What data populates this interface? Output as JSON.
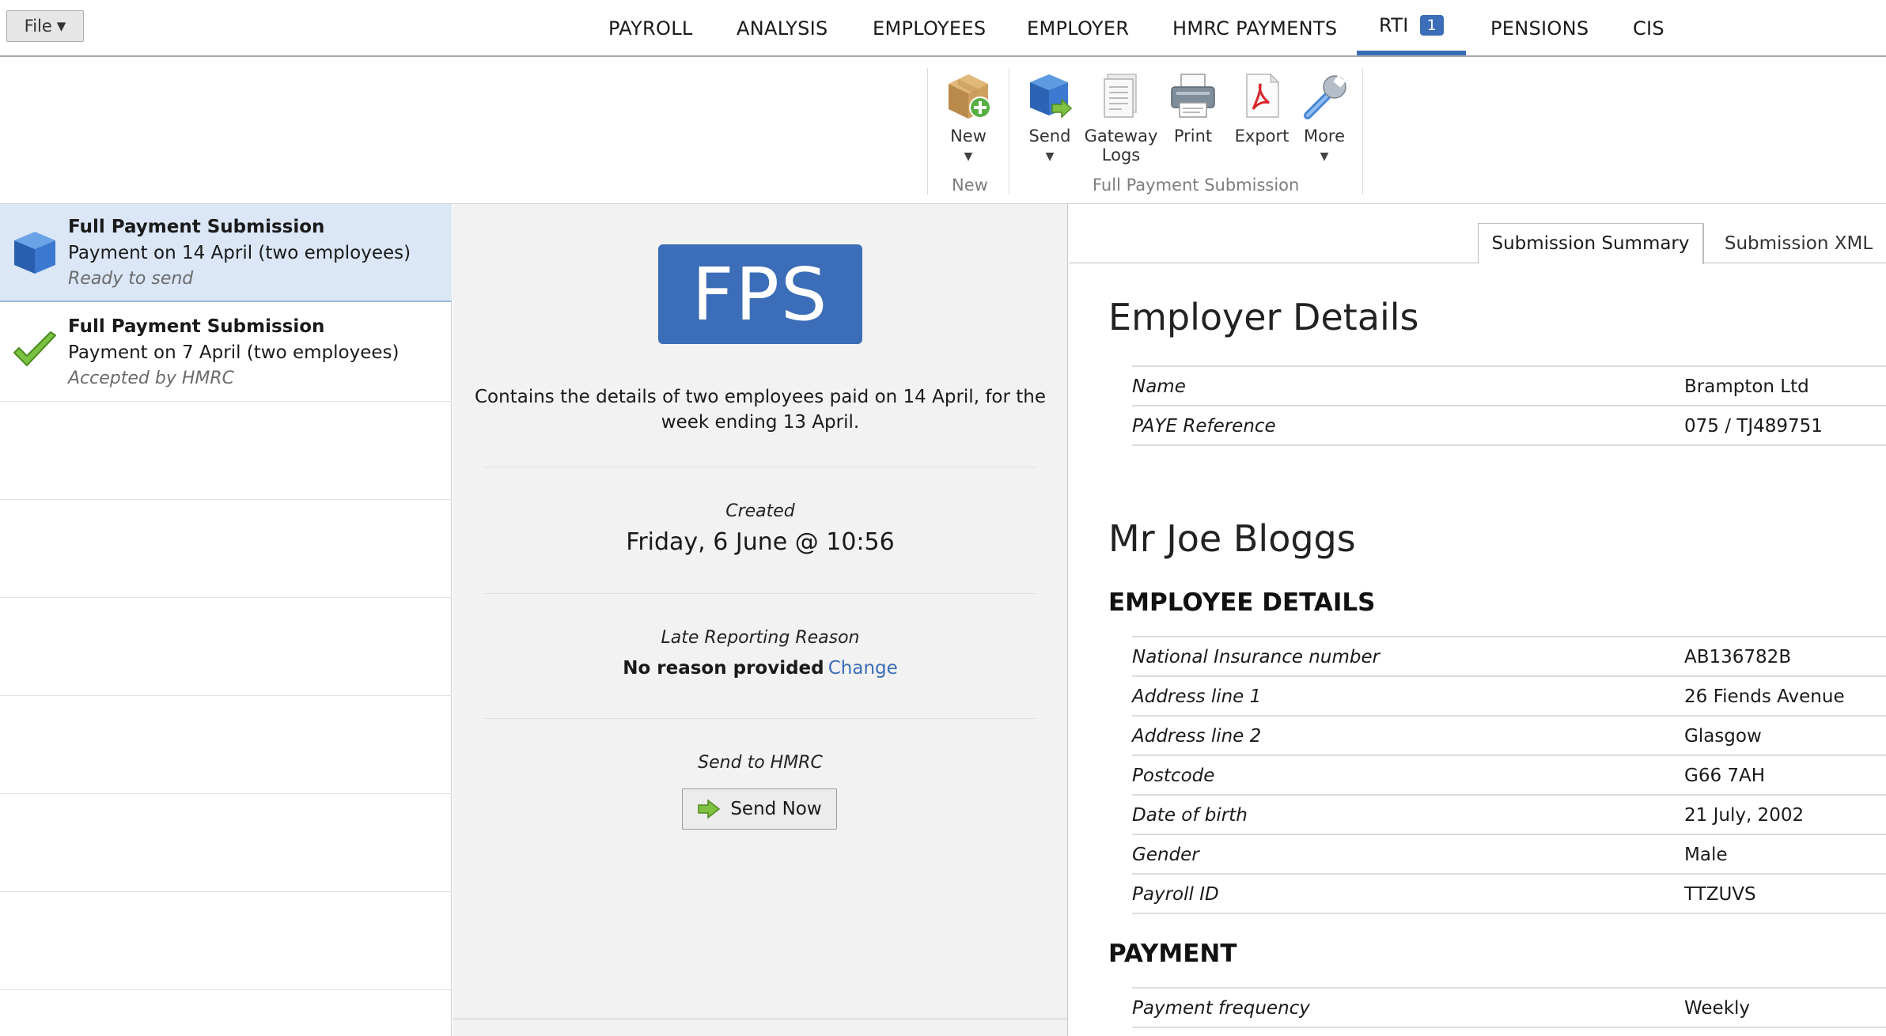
{
  "file_menu": {
    "label": "File"
  },
  "nav": {
    "tabs": [
      {
        "label": "PAYROLL"
      },
      {
        "label": "ANALYSIS"
      },
      {
        "label": "EMPLOYEES"
      },
      {
        "label": "EMPLOYER"
      },
      {
        "label": "HMRC PAYMENTS"
      },
      {
        "label": "RTI",
        "badge": "1",
        "active": true
      },
      {
        "label": "PENSIONS"
      },
      {
        "label": "CIS"
      }
    ]
  },
  "ribbon": {
    "new_button": {
      "label": "New",
      "icon": "package-add-icon"
    },
    "send_button": {
      "label": "Send",
      "icon": "blue-cube-send-icon"
    },
    "gateway_button": {
      "label_line1": "Gateway",
      "label_line2": "Logs",
      "icon": "document-icon"
    },
    "print_button": {
      "label": "Print",
      "icon": "printer-icon"
    },
    "export_button": {
      "label": "Export",
      "icon": "pdf-icon"
    },
    "more_button": {
      "label": "More",
      "icon": "wrench-icon"
    },
    "group_new": "New",
    "group_fps": "Full Payment Submission"
  },
  "submissions": [
    {
      "title": "Full Payment Submission",
      "subtitle": "Payment on 14 April (two employees)",
      "status": "Ready to send",
      "icon": "blue-cube-icon",
      "selected": true
    },
    {
      "title": "Full Payment Submission",
      "subtitle": "Payment on 7 April (two employees)",
      "status": "Accepted by HMRC",
      "icon": "green-check-icon",
      "selected": false
    }
  ],
  "detail": {
    "badge": "FPS",
    "description": "Contains the details of two employees paid on 14 April, for the week ending 13 April.",
    "created_label": "Created",
    "created_value": "Friday, 6 June @ 10:56",
    "late_label": "Late Reporting Reason",
    "late_value": "No reason provided",
    "late_change": "Change",
    "send_label": "Send to HMRC",
    "send_button": "Send Now"
  },
  "summary": {
    "tabs": [
      {
        "label": "Submission Summary",
        "active": true
      },
      {
        "label": "Submission XML",
        "active": false
      }
    ],
    "employer_heading": "Employer Details",
    "employer_rows": [
      {
        "label": "Name",
        "value": "Brampton Ltd"
      },
      {
        "label": "PAYE Reference",
        "value": "075 / TJ489751"
      }
    ],
    "employee_name": "Mr Joe Bloggs",
    "employee_details_heading": "EMPLOYEE DETAILS",
    "employee_rows": [
      {
        "label": "National Insurance number",
        "value": "AB136782B"
      },
      {
        "label": "Address line 1",
        "value": "26 Fiends Avenue"
      },
      {
        "label": "Address line 2",
        "value": "Glasgow"
      },
      {
        "label": "Postcode",
        "value": "G66 7AH"
      },
      {
        "label": "Date of birth",
        "value": "21 July, 2002"
      },
      {
        "label": "Gender",
        "value": "Male"
      },
      {
        "label": "Payroll ID",
        "value": "TTZUVS"
      }
    ],
    "payment_heading": "PAYMENT",
    "payment_rows": [
      {
        "label": "Payment frequency",
        "value": "Weekly"
      }
    ]
  },
  "colors": {
    "accent": "#3b6db8",
    "selected_row": "#dbe6f6",
    "middle_bg": "#f2f2f2"
  }
}
